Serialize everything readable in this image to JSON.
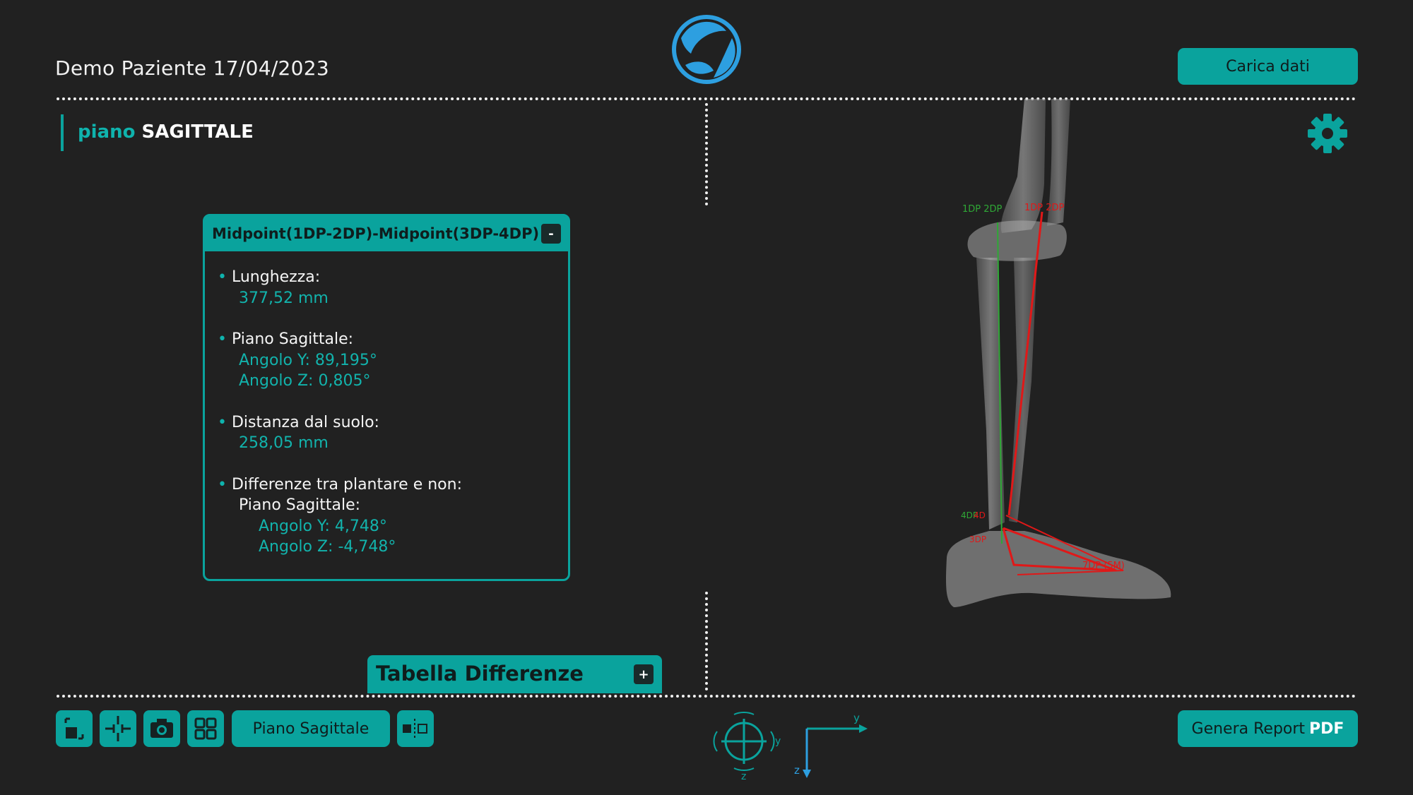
{
  "header": {
    "patient_title": "Demo Paziente 17/04/2023",
    "load_button": "Carica dati",
    "logo_icon": "leaf-logo-icon"
  },
  "view": {
    "plane_prefix": "piano",
    "plane_name": "SAGITTALE",
    "settings_icon": "gear-icon"
  },
  "panel": {
    "title": "Midpoint(1DP-2DP)-Midpoint(3DP-4DP)",
    "collapse_label": "-",
    "length_label": "Lunghezza:",
    "length_value": "377,52 mm",
    "sagittal_label": "Piano Sagittale:",
    "angle_y": "Angolo Y: 89,195°",
    "angle_z": "Angolo Z: 0,805°",
    "ground_label": "Distanza dal suolo:",
    "ground_value": "258,05 mm",
    "diff_label": "Differenze tra plantare e non:",
    "diff_plane": "Piano Sagittale:",
    "diff_angle_y": "Angolo Y: 4,748°",
    "diff_angle_z": "Angolo Z: -4,748°"
  },
  "diff_table": {
    "title": "Tabella Differenze",
    "expand_label": "+"
  },
  "toolbar": {
    "tools": [
      "select-area-icon",
      "crosshair-icon",
      "camera-icon",
      "grid-icon"
    ],
    "plane_button": "Piano Sagittale",
    "split_icon": "split-view-icon",
    "report_label": "Genera Report",
    "report_suffix": "PDF"
  },
  "axes": {
    "gizmo_y": "y",
    "gizmo_z": "z",
    "axis_y": "y",
    "axis_z": "z"
  },
  "colors": {
    "accent": "#0aa39d",
    "background": "#212121",
    "green_marker": "#2fa836",
    "red_marker": "#e01818"
  }
}
